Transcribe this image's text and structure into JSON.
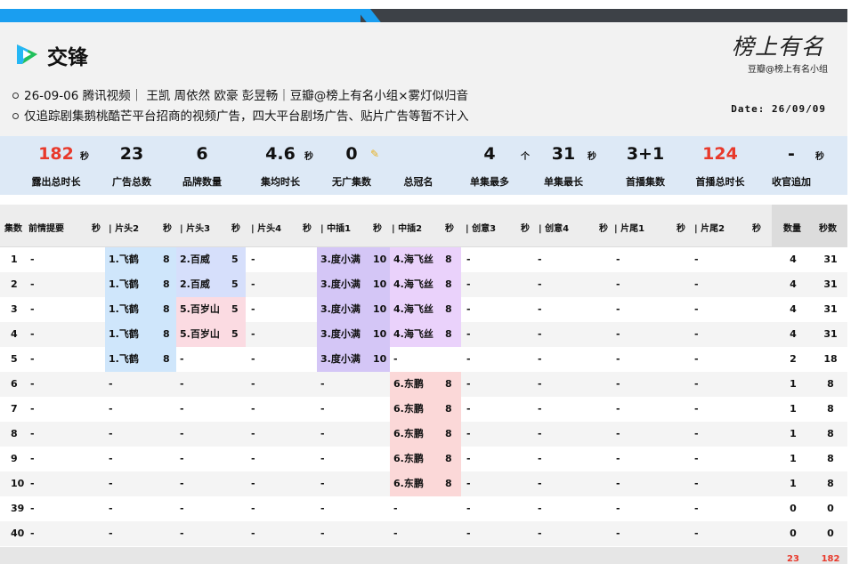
{
  "header": {
    "title": "交锋",
    "info_line1": "26-09-06  腾讯视频｜ 王凯 周依然 欧豪 彭昱畅｜豆瓣@榜上有名小组×雾灯似归音",
    "info_line2": "仅追踪剧集鹅桃酷芒平台招商的视频广告，四大平台剧场广告、贴片广告等暂不计入",
    "date": "Date: 26/09/09",
    "brand_script": "榜上有名",
    "brand_sub": "豆瓣@榜上有名小组",
    "colors": {
      "accent_blue": "#1a9ef0",
      "dark_bar": "#3d4147",
      "highlight_red": "#e8392b"
    }
  },
  "stats": [
    {
      "value": "182",
      "unit": "秒",
      "label": "露出总时长",
      "red": true
    },
    {
      "value": "23",
      "unit": "",
      "label": "广告总数"
    },
    {
      "value": "6",
      "unit": "",
      "label": "品牌数量"
    },
    {
      "value": "4.6",
      "unit": "秒",
      "label": "集均时长"
    },
    {
      "value": "0",
      "unit": "",
      "label": "无广集数",
      "icon": "pencil-icon"
    },
    {
      "value": "",
      "unit": "",
      "label": "总冠名"
    },
    {
      "value": "4",
      "unit": "个",
      "label": "单集最多"
    },
    {
      "value": "31",
      "unit": "秒",
      "label": "单集最长"
    },
    {
      "value": "3+1",
      "unit": "",
      "label": "首播集数"
    },
    {
      "value": "124",
      "unit": "",
      "label": "首播总时长",
      "red": true
    },
    {
      "value": "-",
      "unit": "秒",
      "label": "收官追加"
    }
  ],
  "table": {
    "headers": [
      "集数",
      "前情提要",
      "秒",
      "| 片头2",
      "秒",
      "| 片头3",
      "秒",
      "| 片头4",
      "秒",
      "| 中插1",
      "秒",
      "| 中插2",
      "秒",
      "| 创意3",
      "秒",
      "| 创意4",
      "秒",
      "| 片尾1",
      "秒",
      "| 片尾2",
      "秒",
      "数量",
      "秒数"
    ],
    "rows": [
      {
        "ep": "1",
        "prev": "-",
        "p2": "1.飞鹤",
        "p2s": "8",
        "p3": "2.百威",
        "p3s": "5",
        "p4": "-",
        "m1": "3.度小满",
        "m1s": "10",
        "m2": "4.海飞丝",
        "m2s": "8",
        "c3": "-",
        "c4": "-",
        "e1": "-",
        "e2": "-",
        "count": "4",
        "secs": "31"
      },
      {
        "ep": "2",
        "prev": "-",
        "p2": "1.飞鹤",
        "p2s": "8",
        "p3": "2.百威",
        "p3s": "5",
        "p4": "-",
        "m1": "3.度小满",
        "m1s": "10",
        "m2": "4.海飞丝",
        "m2s": "8",
        "c3": "-",
        "c4": "-",
        "e1": "-",
        "e2": "-",
        "count": "4",
        "secs": "31"
      },
      {
        "ep": "3",
        "prev": "-",
        "p2": "1.飞鹤",
        "p2s": "8",
        "p3": "5.百岁山",
        "p3s": "5",
        "p4": "-",
        "m1": "3.度小满",
        "m1s": "10",
        "m2": "4.海飞丝",
        "m2s": "8",
        "c3": "-",
        "c4": "-",
        "e1": "-",
        "e2": "-",
        "count": "4",
        "secs": "31"
      },
      {
        "ep": "4",
        "prev": "-",
        "p2": "1.飞鹤",
        "p2s": "8",
        "p3": "5.百岁山",
        "p3s": "5",
        "p4": "-",
        "m1": "3.度小满",
        "m1s": "10",
        "m2": "4.海飞丝",
        "m2s": "8",
        "c3": "-",
        "c4": "-",
        "e1": "-",
        "e2": "-",
        "count": "4",
        "secs": "31"
      },
      {
        "ep": "5",
        "prev": "-",
        "p2": "1.飞鹤",
        "p2s": "8",
        "p3": "-",
        "p3s": "",
        "p4": "-",
        "m1": "3.度小满",
        "m1s": "10",
        "m2": "-",
        "m2s": "",
        "c3": "-",
        "c4": "-",
        "e1": "-",
        "e2": "-",
        "count": "2",
        "secs": "18"
      },
      {
        "ep": "6",
        "prev": "-",
        "p2": "-",
        "p2s": "",
        "p3": "-",
        "p3s": "",
        "p4": "-",
        "m1": "-",
        "m1s": "",
        "m2": "6.东鹏",
        "m2s": "8",
        "c3": "-",
        "c4": "-",
        "e1": "-",
        "e2": "-",
        "count": "1",
        "secs": "8"
      },
      {
        "ep": "7",
        "prev": "-",
        "p2": "-",
        "p2s": "",
        "p3": "-",
        "p3s": "",
        "p4": "-",
        "m1": "-",
        "m1s": "",
        "m2": "6.东鹏",
        "m2s": "8",
        "c3": "-",
        "c4": "-",
        "e1": "-",
        "e2": "-",
        "count": "1",
        "secs": "8"
      },
      {
        "ep": "8",
        "prev": "-",
        "p2": "-",
        "p2s": "",
        "p3": "-",
        "p3s": "",
        "p4": "-",
        "m1": "-",
        "m1s": "",
        "m2": "6.东鹏",
        "m2s": "8",
        "c3": "-",
        "c4": "-",
        "e1": "-",
        "e2": "-",
        "count": "1",
        "secs": "8"
      },
      {
        "ep": "9",
        "prev": "-",
        "p2": "-",
        "p2s": "",
        "p3": "-",
        "p3s": "",
        "p4": "-",
        "m1": "-",
        "m1s": "",
        "m2": "6.东鹏",
        "m2s": "8",
        "c3": "-",
        "c4": "-",
        "e1": "-",
        "e2": "-",
        "count": "1",
        "secs": "8"
      },
      {
        "ep": "10",
        "prev": "-",
        "p2": "-",
        "p2s": "",
        "p3": "-",
        "p3s": "",
        "p4": "-",
        "m1": "-",
        "m1s": "",
        "m2": "6.东鹏",
        "m2s": "8",
        "c3": "-",
        "c4": "-",
        "e1": "-",
        "e2": "-",
        "count": "1",
        "secs": "8"
      },
      {
        "ep": "39",
        "prev": "-",
        "p2": "-",
        "p2s": "",
        "p3": "-",
        "p3s": "",
        "p4": "-",
        "m1": "-",
        "m1s": "",
        "m2": "-",
        "m2s": "",
        "c3": "-",
        "c4": "-",
        "e1": "-",
        "e2": "-",
        "count": "0",
        "secs": "0"
      },
      {
        "ep": "40",
        "prev": "-",
        "p2": "-",
        "p2s": "",
        "p3": "-",
        "p3s": "",
        "p4": "-",
        "m1": "-",
        "m1s": "",
        "m2": "-",
        "m2s": "",
        "c3": "-",
        "c4": "-",
        "e1": "-",
        "e2": "-",
        "count": "0",
        "secs": "0"
      }
    ],
    "totals": {
      "count": "23",
      "secs": "182"
    }
  }
}
